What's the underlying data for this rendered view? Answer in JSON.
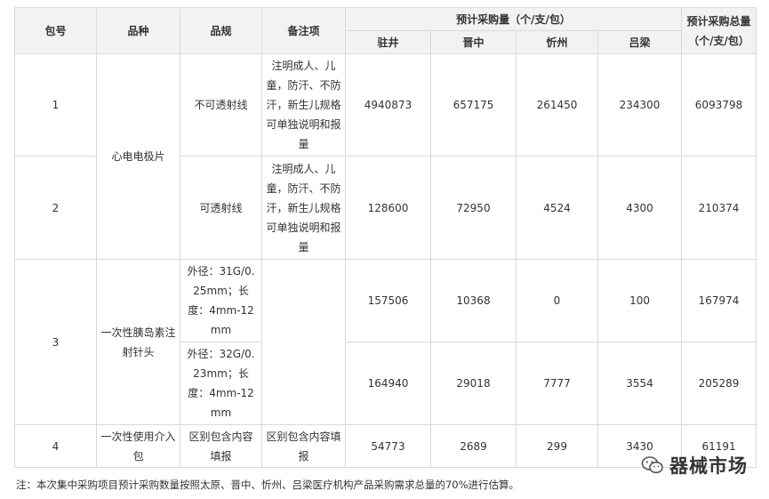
{
  "headers": {
    "package_no": "包号",
    "variety": "品种",
    "spec": "品规",
    "remarks": "备注项",
    "estimated_qty": "预计采购量（个/支/包）",
    "total_qty_line1": "预计采购总量",
    "total_qty_line2": "（个/支/包）",
    "regions": [
      "驻井",
      "晋中",
      "忻州",
      "吕梁"
    ]
  },
  "groups": [
    {
      "package_no": "1",
      "variety": "心电电极片"
    },
    {
      "package_no": "3",
      "variety": "一次性胰岛素注射针头"
    },
    {
      "package_no": "4",
      "variety": "一次性使用介入包"
    }
  ],
  "rows": [
    {
      "package_no": "1",
      "spec": "不可透射线",
      "remarks": "注明成人、儿童，防汗、不防汗，新生儿规格可单独说明和报量",
      "values": [
        "4940873",
        "657175",
        "261450",
        "234300"
      ],
      "total": "6093798"
    },
    {
      "package_no": "2",
      "spec": "可透射线",
      "remarks": "注明成人、儿童，防汗、不防汗，新生儿规格可单独说明和报量",
      "values": [
        "128600",
        "72950",
        "4524",
        "4300"
      ],
      "total": "210374"
    },
    {
      "spec": "外径：31G/0.25mm；长度：4mm-12mm",
      "remarks": "",
      "values": [
        "157506",
        "10368",
        "0",
        "100"
      ],
      "total": "167974"
    },
    {
      "spec": "外径：32G/0.23mm；长度：4mm-12mm",
      "values": [
        "164940",
        "29018",
        "7777",
        "3554"
      ],
      "total": "205289"
    },
    {
      "spec": "区别包含内容填报",
      "remarks": "区别包含内容填报",
      "values": [
        "54773",
        "2689",
        "299",
        "3430"
      ],
      "total": "61191"
    }
  ],
  "footnote": "注：本次集中采购项目预计采购数量按照太原、晋中、忻州、吕梁医疗机构产品采购需求总量的70%进行估算。",
  "watermark": {
    "icon": "wechat-icon",
    "text": "器械市场"
  }
}
